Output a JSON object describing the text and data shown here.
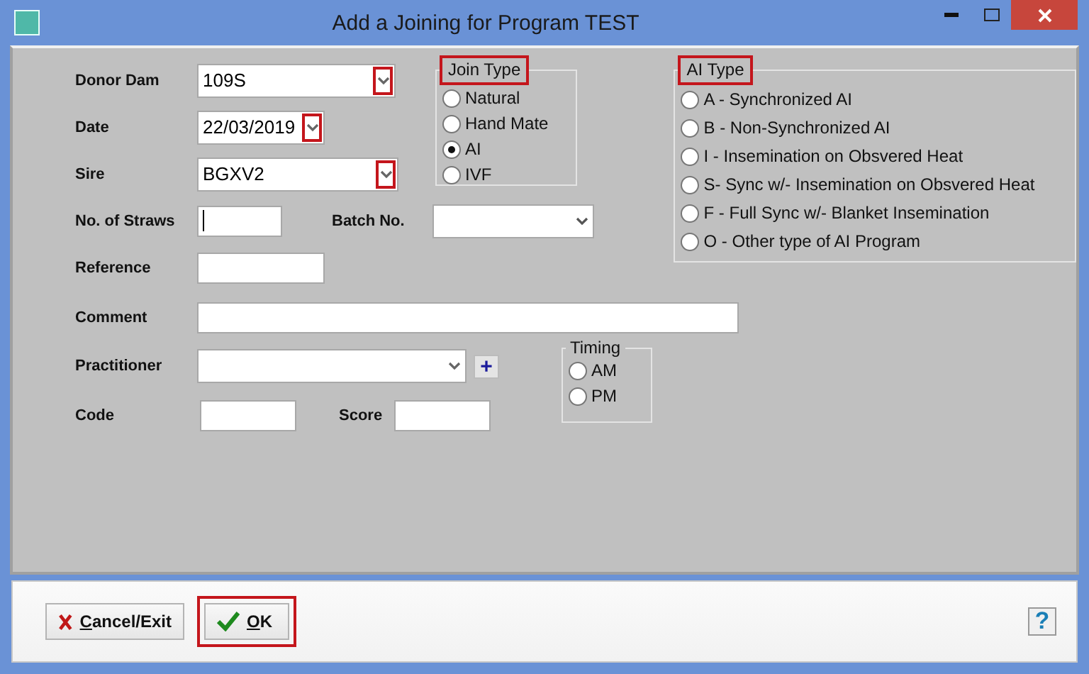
{
  "window": {
    "title": "Add a Joining for Program TEST"
  },
  "donor_dam": {
    "label": "Donor Dam",
    "value": "109S",
    "highlighted": true
  },
  "date": {
    "label": "Date",
    "value": "22/03/2019",
    "highlighted": true
  },
  "sire": {
    "label": "Sire",
    "value": "BGXV2",
    "highlighted": true
  },
  "straws": {
    "label": "No. of Straws",
    "focused": true
  },
  "batch": {
    "label": "Batch No."
  },
  "reference": {
    "label": "Reference"
  },
  "comment": {
    "label": "Comment"
  },
  "practitioner": {
    "label": "Practitioner",
    "add_button": "+"
  },
  "code": {
    "label": "Code"
  },
  "score": {
    "label": "Score"
  },
  "join_type": {
    "title": "Join Type",
    "highlighted": true,
    "options": [
      {
        "label": "Natural",
        "selected": false
      },
      {
        "label": "Hand Mate",
        "selected": false
      },
      {
        "label": "AI",
        "selected": true
      },
      {
        "label": "IVF",
        "selected": false
      }
    ]
  },
  "ai_type": {
    "title": "AI Type",
    "highlighted": true,
    "options": [
      {
        "label": "A - Synchronized AI",
        "selected": false
      },
      {
        "label": "B - Non-Synchronized AI",
        "selected": false
      },
      {
        "label": "I - Insemination on Obsvered Heat",
        "selected": false
      },
      {
        "label": "S- Sync w/- Insemination on Obsvered Heat",
        "selected": false
      },
      {
        "label": "F - Full Sync w/- Blanket Insemination",
        "selected": false
      },
      {
        "label": "O - Other type of AI Program",
        "selected": false
      }
    ]
  },
  "timing": {
    "title": "Timing",
    "options": [
      {
        "label": "AM",
        "selected": false
      },
      {
        "label": "PM",
        "selected": false
      }
    ]
  },
  "buttons": [
    {
      "label": "Cancel/Exit",
      "kind": "cancel",
      "highlighted": false
    },
    {
      "label": "OK",
      "kind": "ok",
      "highlighted": true
    }
  ],
  "help_button": "?"
}
